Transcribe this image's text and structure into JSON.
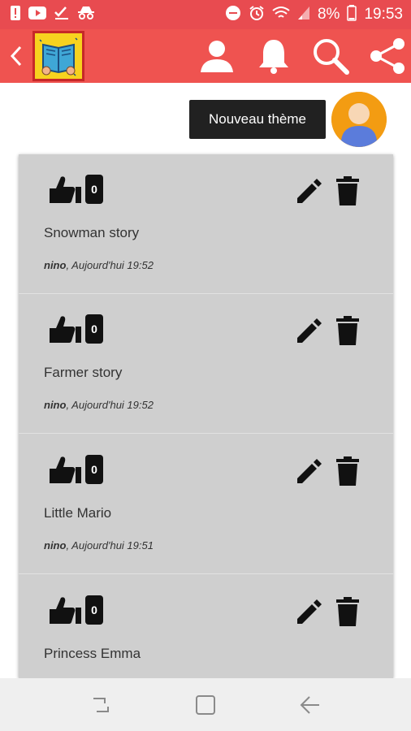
{
  "status_bar": {
    "battery_text": "8%",
    "time": "19:53",
    "icons": [
      "alert-icon",
      "youtube-icon",
      "checklist-icon",
      "incognito-icon",
      "dnd-icon",
      "alarm-icon",
      "wifi-icon",
      "signal-icon",
      "battery-icon"
    ]
  },
  "app_bar": {
    "actions": [
      "profile-icon",
      "bell-icon",
      "search-icon",
      "share-icon"
    ],
    "colors": {
      "bar": "#ef5350",
      "status": "#e84b50",
      "logo_bg": "#f7d21f"
    }
  },
  "new_theme_label": "Nouveau thème",
  "stories": [
    {
      "title": "Snowman story",
      "author": "nino",
      "date": ", Aujourd'hui 19:52",
      "likes": "0"
    },
    {
      "title": "Farmer story",
      "author": "nino",
      "date": ", Aujourd'hui 19:52",
      "likes": "0"
    },
    {
      "title": "Little Mario",
      "author": "nino",
      "date": ", Aujourd'hui 19:51",
      "likes": "0"
    },
    {
      "title": "Princess Emma",
      "author": "",
      "date": "",
      "likes": "0"
    }
  ],
  "nav": [
    "recents-icon",
    "home-icon",
    "back-icon"
  ]
}
